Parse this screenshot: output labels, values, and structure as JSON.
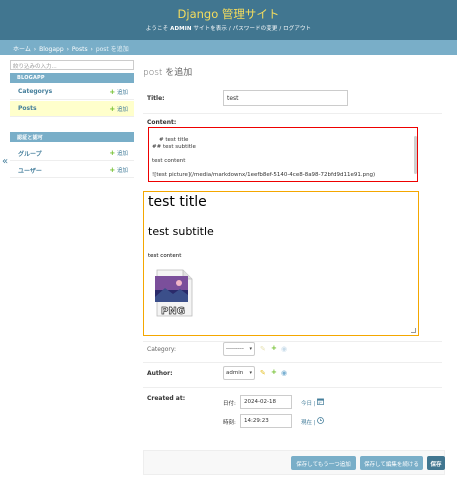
{
  "header": {
    "site_name": "Django 管理サイト",
    "welcome": "ようこそ",
    "username": "ADMIN",
    "view_site": "サイトを表示",
    "change_password": "パスワードの変更",
    "logout": "ログアウト",
    "separator": " / "
  },
  "breadcrumbs": {
    "home": "ホーム",
    "app": "Blogapp",
    "model": "Posts",
    "current": "post を追加",
    "separator": "›"
  },
  "sidebar": {
    "filter_placeholder": "絞り込みの入力...",
    "modules": [
      {
        "caption": "BLOGAPP",
        "rows": [
          {
            "name": "Categorys",
            "add": "追加"
          },
          {
            "name": "Posts",
            "add": "追加"
          }
        ]
      },
      {
        "caption": "認証と認可",
        "rows": [
          {
            "name": "グループ",
            "add": "追加"
          },
          {
            "name": "ユーザー",
            "add": "追加"
          }
        ]
      }
    ],
    "collapse_glyph": "«"
  },
  "form": {
    "page_title": "post を追加",
    "title_label": "Title:",
    "title_value": "test",
    "content_label": "Content:",
    "content_value": "# test title\n## test subtitle\n\ntest content\n\n![test picture](/media/markdownx/1eefb8ef-5140-4ce8-8a98-72bfd9d11e91.png)",
    "preview": {
      "h1": "test title",
      "h2": "test subtitle",
      "p": "test content",
      "image_label": "PNG"
    },
    "category_label": "Category:",
    "category_value": "---------",
    "author_label": "Author:",
    "author_value": "admin",
    "created_label": "Created at:",
    "date_label": "日付:",
    "date_value": "2024-02-18",
    "date_today": "今日 |",
    "time_label": "時刻:",
    "time_value": "14:29:23",
    "time_now": "現在 |"
  },
  "buttons": {
    "save_add_another": "保存してもう一つ追加",
    "save_continue": "保存して編集を続ける",
    "save": "保存"
  },
  "colors": {
    "header_bg": "#417690",
    "site_name": "#f5dd5d",
    "breadcrumbs_bg": "#79aec8",
    "link": "#447e9b",
    "add_plus": "#70bf2b",
    "textarea_highlight": "#e00000",
    "preview_highlight": "#f4a700"
  },
  "icons": {
    "add": "plus-icon",
    "change": "pencil-icon",
    "view": "eye-icon",
    "calendar": "calendar-icon",
    "clock": "clock-icon",
    "select": "chevron-down-icon",
    "collapse": "double-chevron-left-icon"
  }
}
